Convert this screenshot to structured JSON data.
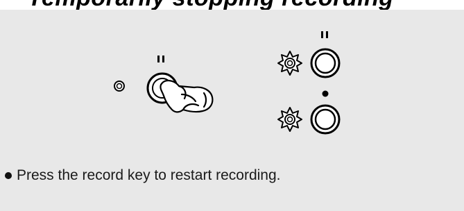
{
  "heading": {
    "text": "Temporarily stopping recording"
  },
  "illustration": {
    "pause_symbol": "‖",
    "record_symbol": "●",
    "icons": [
      "led-indicator-icon",
      "pause-key-icon",
      "pressing-finger-icon",
      "blinking-light-icon",
      "record-key-icon"
    ]
  },
  "instruction": {
    "text": "Press the record key to restart recording."
  }
}
